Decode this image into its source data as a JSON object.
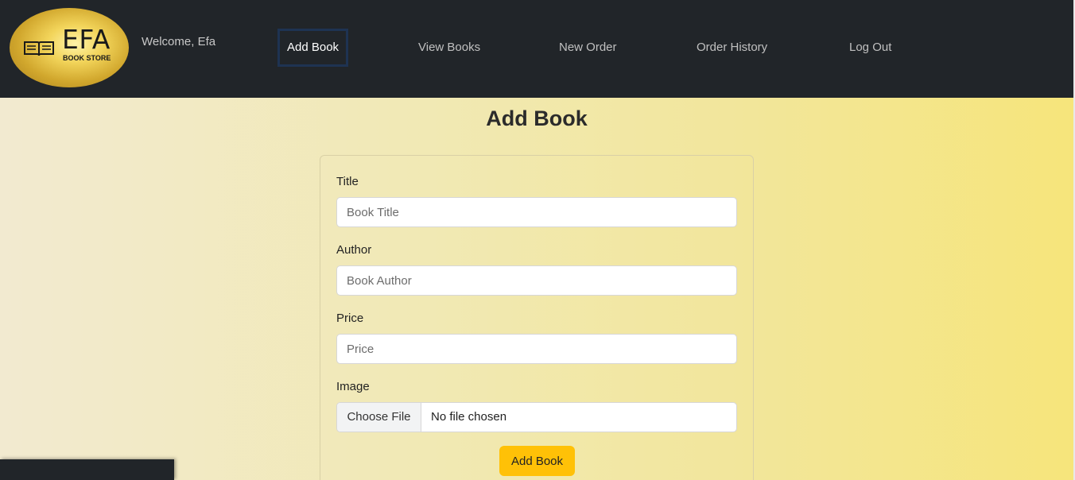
{
  "brand": {
    "logo_text": "EFA",
    "logo_subtext": "BOOK STORE",
    "icon": "open-book-icon"
  },
  "header": {
    "welcome": "Welcome, Efa"
  },
  "nav": {
    "items": [
      {
        "label": "Add Book",
        "active": true
      },
      {
        "label": "View Books",
        "active": false
      },
      {
        "label": "New Order",
        "active": false
      },
      {
        "label": "Order History",
        "active": false
      },
      {
        "label": "Log Out",
        "active": false
      }
    ]
  },
  "main": {
    "title": "Add Book"
  },
  "form": {
    "title_label": "Title",
    "title_placeholder": "Book Title",
    "author_label": "Author",
    "author_placeholder": "Book Author",
    "price_label": "Price",
    "price_placeholder": "Price",
    "image_label": "Image",
    "file_button": "Choose File",
    "file_status": "No file chosen",
    "submit_label": "Add Book"
  },
  "colors": {
    "navbar": "#212529",
    "accent": "#ffc107",
    "active_border": "#1e3352"
  }
}
